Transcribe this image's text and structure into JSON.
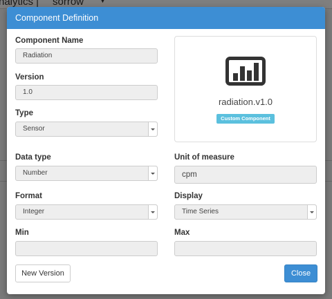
{
  "background": {
    "tab_left": "nalytics |",
    "tab_right": "sorrow"
  },
  "modal": {
    "title": "Component Definition",
    "component_name": {
      "label": "Component Name",
      "value": "Radiation"
    },
    "version": {
      "label": "Version",
      "value": "1.0"
    },
    "type": {
      "label": "Type",
      "value": "Sensor"
    },
    "data_type": {
      "label": "Data type",
      "value": "Number"
    },
    "unit_of_measure": {
      "label": "Unit of measure",
      "value": "cpm"
    },
    "format": {
      "label": "Format",
      "value": "Integer"
    },
    "display": {
      "label": "Display",
      "value": "Time Series"
    },
    "min": {
      "label": "Min",
      "value": ""
    },
    "max": {
      "label": "Max",
      "value": ""
    },
    "preview": {
      "icon": "bar-chart-icon",
      "name": "radiation.v1.0",
      "badge": "Custom Component"
    },
    "buttons": {
      "new_version": "New Version",
      "close": "Close"
    }
  },
  "colors": {
    "header": "#3d8ed4",
    "badge": "#5bc0de",
    "primary_button": "#3d8ed4"
  }
}
